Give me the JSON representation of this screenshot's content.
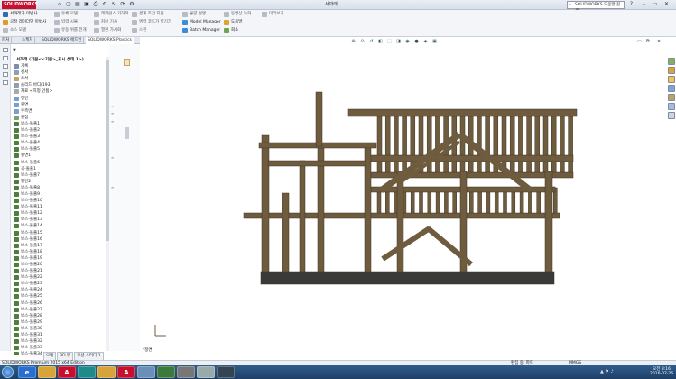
{
  "app": {
    "logo": "SOLIDWORKS",
    "title": "서까래",
    "search_placeholder": "SOLIDWORKS 도움말 검색",
    "colors": {
      "wood": "#6f5c3f",
      "wood_edge": "#3e3222",
      "base": "#3a3a3a",
      "accent": "#c8102e"
    }
  },
  "ribbon": {
    "row1": [
      "서까래가 마법사",
      "유체 모델",
      "레퍼런스 기하학",
      "경계 조건 지원",
      "불량 설명",
      "동영상 녹화",
      "미리보기"
    ],
    "row2": [
      "공정 레이더언 마법사",
      "입력 시뮬",
      "커브 기사",
      "명령 코드가 넣기가",
      "Model Manager",
      "도움말"
    ],
    "row3": [
      "소스 모델",
      "유동 위를 전개",
      "열원 가시화",
      "스핀",
      "Batch Manager",
      "회소"
    ]
  },
  "tabs": [
    "피처",
    "스케치",
    "SOLIDWORKS 애드인",
    "SOLIDWORKS Plastics"
  ],
  "tree": {
    "root": "서까래 (기본<<기본>_표시 상태 1>)",
    "items": [
      "기록",
      "센서",
      "주석",
      "솔리드 바디(193)",
      "재료 <지정 안됨>",
      "정면",
      "윗면",
      "우측면",
      "원점",
      "보스-돌출1",
      "보스-돌출2",
      "보스-돌출3",
      "보스-돌출4",
      "보스-돌출5",
      "평면1",
      "보스-돌출6",
      "곡-돌출1",
      "보스-돌출7",
      "평면2",
      "보스-돌출8",
      "보스-돌출9",
      "보스-돌출10",
      "보스-돌출11",
      "보스-돌출12",
      "보스-돌출13",
      "보스-돌출14",
      "보스-돌출15",
      "보스-돌출16",
      "보스-돌출17",
      "보스-돌출18",
      "보스-돌출19",
      "보스-돌출20",
      "보스-돌출21",
      "보스-돌출22",
      "보스-돌출23",
      "보스-돌출24",
      "보스-돌출25",
      "보스-돌출26",
      "보스-돌출27",
      "보스-돌출28",
      "보스-돌출29",
      "보스-돌출30",
      "보스-돌출31",
      "보스-돌출32",
      "보스-돌출33",
      "보스-돌출34"
    ]
  },
  "bottom_tabs": [
    "모델",
    "3D 뷰",
    "모션 스터디 1"
  ],
  "viewport": {
    "view_label": "*정면"
  },
  "status": {
    "left": "SOLIDWORKS Premium 2015 x64 Edition",
    "mid": "편집 중: 파트",
    "units": "MMGS"
  },
  "taskbar": {
    "apps": [
      "e",
      "",
      "A",
      "",
      "",
      "A",
      "",
      "",
      "",
      "",
      ""
    ],
    "time": "오전 8:16",
    "date": "2016-07-26"
  }
}
